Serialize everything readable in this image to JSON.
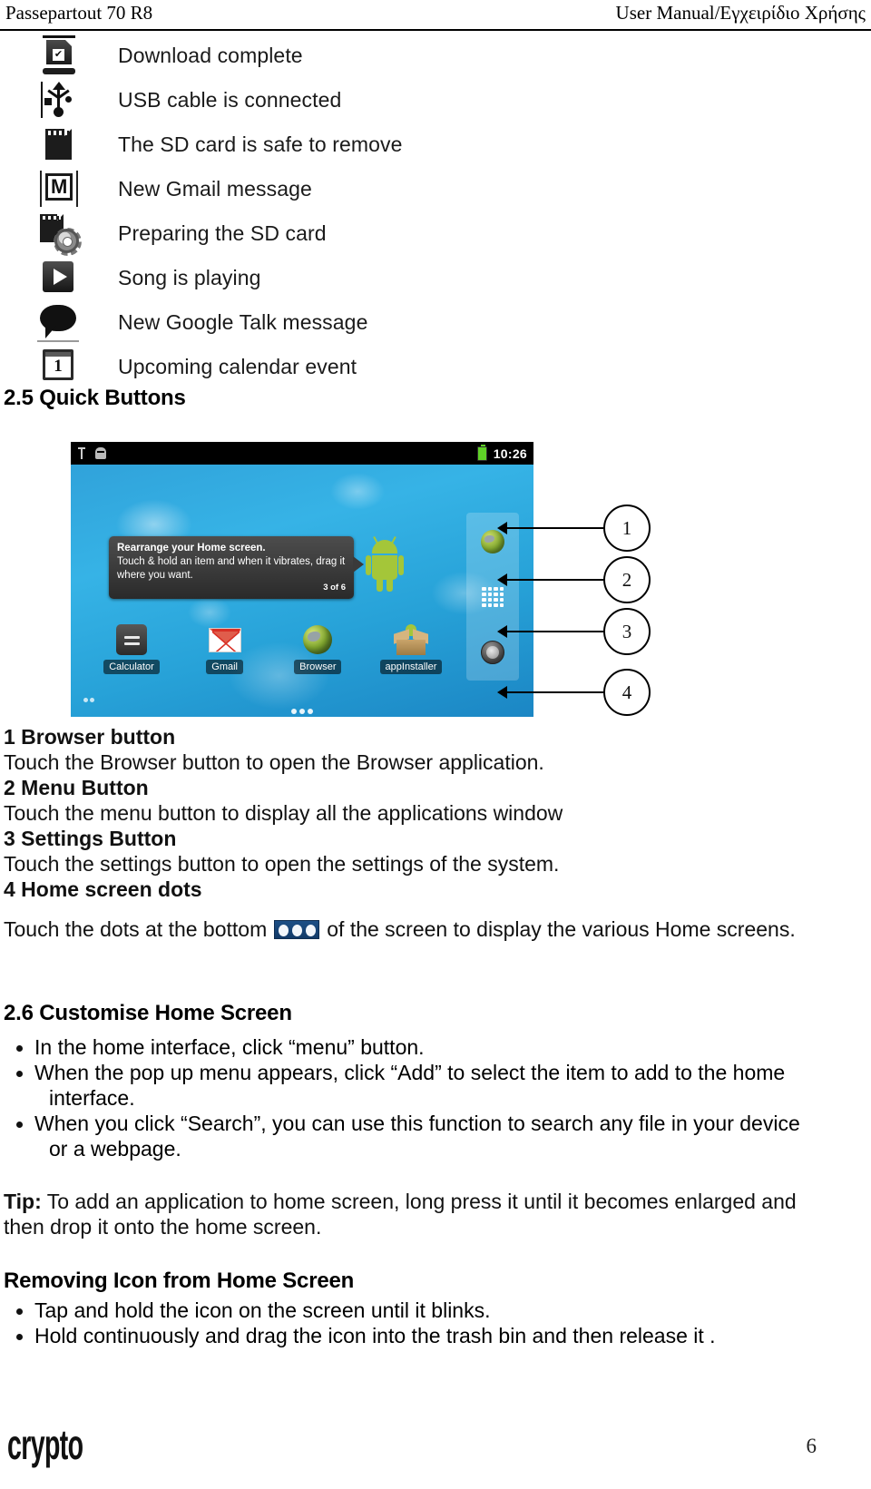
{
  "header": {
    "left": "Passepartout 70 R8",
    "right": "User Manual/Εγχειρίδιο Χρήσης"
  },
  "status_icons": {
    "items": [
      {
        "icon": "download-complete-icon",
        "label": "Download complete"
      },
      {
        "icon": "usb-connected-icon",
        "label": "USB cable is connected"
      },
      {
        "icon": "sd-card-safe-icon",
        "label": "The SD card is safe to remove"
      },
      {
        "icon": "gmail-icon",
        "label": "New Gmail message"
      },
      {
        "icon": "sd-card-preparing-icon",
        "label": "Preparing the SD card"
      },
      {
        "icon": "music-play-icon",
        "label": "Song is playing"
      },
      {
        "icon": "google-talk-icon",
        "label": "New Google Talk message"
      },
      {
        "icon": "calendar-event-icon",
        "label": "Upcoming calendar event"
      }
    ],
    "calendar_day": "1"
  },
  "section_2_5": {
    "heading": "2.5 Quick Buttons",
    "figure": {
      "statusbar": {
        "clock": "10:26"
      },
      "tooltip": {
        "title": "Rearrange your Home screen.",
        "body": "Touch & hold an item and when it vibrates, drag it where you want.",
        "counter": "3 of 6"
      },
      "apps": [
        {
          "icon": "calculator-icon",
          "name": "Calculator"
        },
        {
          "icon": "gmail-app-icon",
          "name": "Gmail"
        },
        {
          "icon": "browser-app-icon",
          "name": "Browser"
        },
        {
          "icon": "appinstaller-icon",
          "name": "appInstaller"
        }
      ],
      "callouts": [
        {
          "number": "1",
          "target": "browser-button"
        },
        {
          "number": "2",
          "target": "menu-button"
        },
        {
          "number": "3",
          "target": "settings-button"
        },
        {
          "number": "4",
          "target": "home-screen-dots"
        }
      ]
    },
    "entries": [
      {
        "title": "1 Browser button",
        "text": "Touch the Browser button to open the Browser application."
      },
      {
        "title": "2 Menu Button",
        "text": "Touch the menu button to display all the applications window"
      },
      {
        "title": "3 Settings Button",
        "text": "Touch the settings button to open the settings of the system."
      },
      {
        "title": "4 Home screen dots",
        "text_before": "Touch the dots at the bottom",
        "text_after": "of the screen to display the various Home screens."
      }
    ]
  },
  "section_2_6": {
    "heading": "2.6 Customise Home Screen",
    "bullets": [
      {
        "text": "In the home interface, click “menu” button."
      },
      {
        "text": "When the pop up menu appears, click “Add” to select the item to add to the home",
        "continuation": "interface."
      },
      {
        "text": "When you click “Search”, you can use this function to search any file in your device",
        "continuation": "or a webpage."
      }
    ],
    "tip": {
      "label": "Tip:",
      "text": " To add an application to home screen, long press it until it becomes enlarged and",
      "line2": "then drop it  onto the home screen."
    },
    "removing": {
      "heading": "Removing Icon from Home Screen",
      "bullets": [
        "Tap and hold the icon on the screen until it blinks.",
        "Hold continuously and drag the icon into the trash bin and then release it ."
      ]
    }
  },
  "footer": {
    "brand": "crypto",
    "page_number": "6"
  }
}
